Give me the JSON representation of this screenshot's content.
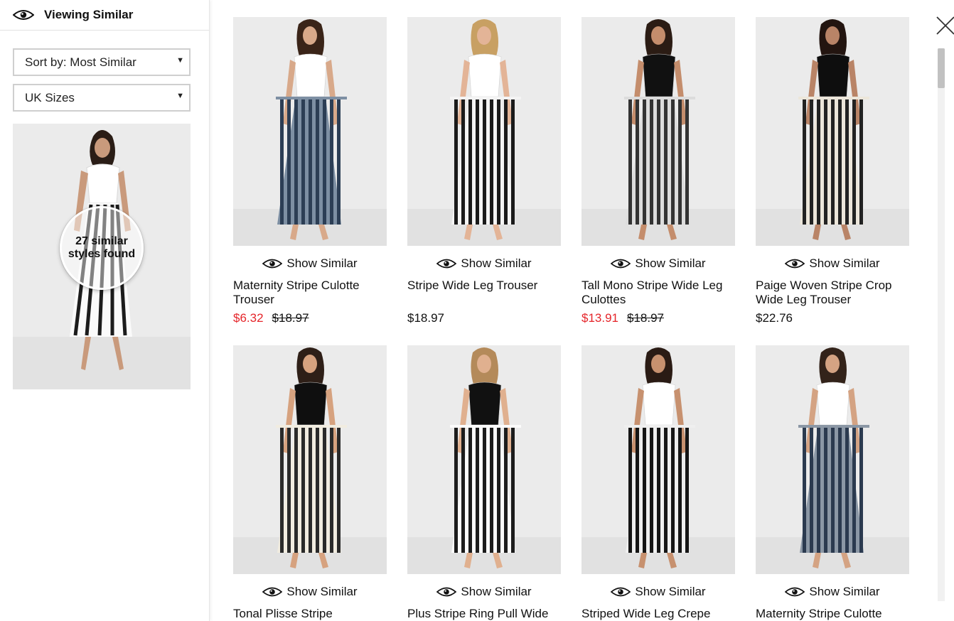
{
  "panel": {
    "title": "Viewing Similar",
    "sort": {
      "value": "Sort by: Most Similar"
    },
    "sizes": {
      "value": "UK Sizes"
    },
    "badge": {
      "line1": "27 similar",
      "line2": "styles found"
    }
  },
  "show_similar_label": "Show Similar",
  "colors": {
    "sale": "#e5252a",
    "accent_border": "#cfcfcf"
  },
  "products": [
    {
      "name": "Maternity Stripe Culotte Trouser",
      "sale_price": "$6.32",
      "was_price": "$18.97",
      "label": "Show Similar"
    },
    {
      "name": "Stripe Wide Leg Trouser",
      "price": "$18.97",
      "label": "Show Similar"
    },
    {
      "name": "Tall Mono Stripe Wide Leg Culottes",
      "sale_price": "$13.91",
      "was_price": "$18.97",
      "label": "Show Similar"
    },
    {
      "name": "Paige Woven Stripe Crop Wide Leg Trouser",
      "price": "$22.76",
      "label": "Show Similar"
    },
    {
      "name": "Tonal Plisse Stripe",
      "label": "Show Similar"
    },
    {
      "name": "Plus Stripe Ring Pull Wide",
      "label": "Show Similar"
    },
    {
      "name": "Striped Wide Leg Crepe",
      "label": "Show Similar"
    },
    {
      "name": "Maternity Stripe Culotte",
      "label": "Show Similar"
    }
  ]
}
